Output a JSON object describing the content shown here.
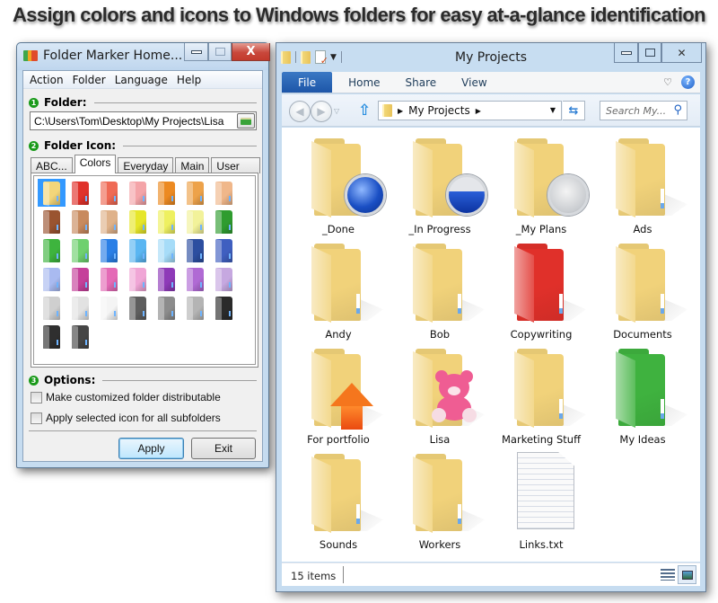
{
  "headline": "Assign colors and icons to Windows folders for easy at-a-glance identification",
  "folder_marker": {
    "title": "Folder Marker Home...",
    "caption_buttons": {
      "minimize": "minimize",
      "maximize": "maximize",
      "close": "X"
    },
    "menu": [
      "Action",
      "Folder",
      "Language",
      "Help"
    ],
    "section_folder": {
      "number": "1",
      "label": "Folder:"
    },
    "folder_path": "C:\\Users\\Tom\\Desktop\\My Projects\\Lisa",
    "section_icon": {
      "number": "2",
      "label": "Folder Icon:"
    },
    "tabs": [
      "ABC...",
      "Colors",
      "Everyday",
      "Main",
      "User Icons"
    ],
    "active_tab": "Colors",
    "color_swatches": [
      [
        "#f3d67a",
        "#e0312a",
        "#ef6a55",
        "#f4a4a8",
        "#ec8a22",
        "#eda24a",
        "#f0b78a"
      ],
      [
        "#9a5430",
        "#c88a5e",
        "#dfb28a",
        "#e6e62a",
        "#eef060",
        "#f2f29a",
        "#2f9c2f"
      ],
      [
        "#3eb43e",
        "#6fd06f",
        "#2a7fe6",
        "#5ab6f2",
        "#a6dcf8",
        "#2c4ea0",
        "#3f5fc0"
      ],
      [
        "#a9baf0",
        "#c5409a",
        "#e46ab6",
        "#f0a6d6",
        "#8e3ab8",
        "#b06ad4",
        "#c6a8e0"
      ],
      [
        "#cfcfcf",
        "#e2e2e2",
        "#f4f4f4",
        "#5e5e5e",
        "#8c8c8c",
        "#b4b4b4",
        "#2a2a2a"
      ],
      [
        "#2f2f2f",
        "#454545"
      ]
    ],
    "selected_swatch": "0,0",
    "section_options": {
      "number": "3",
      "label": "Options:"
    },
    "options": [
      {
        "label": "Make customized folder distributable",
        "checked": false
      },
      {
        "label": "Apply selected icon for all subfolders",
        "checked": false
      }
    ],
    "apply_label": "Apply",
    "exit_label": "Exit"
  },
  "explorer": {
    "title": "My Projects",
    "ribbon_tabs": [
      "File",
      "Home",
      "Share",
      "View"
    ],
    "breadcrumb": [
      "My Projects"
    ],
    "search_placeholder": "Search My...",
    "items": [
      {
        "name": "_Done",
        "type": "folder",
        "color": "#f1d27a",
        "overlay": "blue-orb-full"
      },
      {
        "name": "_In Progress",
        "type": "folder",
        "color": "#f1d27a",
        "overlay": "blue-orb-half"
      },
      {
        "name": "_My Plans",
        "type": "folder",
        "color": "#f1d27a",
        "overlay": "empty-orb"
      },
      {
        "name": "Ads",
        "type": "folder",
        "color": "#f1d27a",
        "overlay": ""
      },
      {
        "name": "Andy",
        "type": "folder",
        "color": "#f1d27a",
        "overlay": ""
      },
      {
        "name": "Bob",
        "type": "folder",
        "color": "#f1d27a",
        "overlay": ""
      },
      {
        "name": "Copywriting",
        "type": "folder",
        "color": "#e0302a",
        "overlay": ""
      },
      {
        "name": "Documents",
        "type": "folder",
        "color": "#f1d27a",
        "overlay": ""
      },
      {
        "name": "For portfolio",
        "type": "folder",
        "color": "#f1d27a",
        "overlay": "orange-up-arrow"
      },
      {
        "name": "Lisa",
        "type": "folder",
        "color": "#f1d27a",
        "overlay": "pink-teddy-bear"
      },
      {
        "name": "Marketing Stuff",
        "type": "folder",
        "color": "#f1d27a",
        "overlay": ""
      },
      {
        "name": "My Ideas",
        "type": "folder",
        "color": "#3fb23f",
        "overlay": ""
      },
      {
        "name": "Sounds",
        "type": "folder",
        "color": "#f1d27a",
        "overlay": ""
      },
      {
        "name": "Workers",
        "type": "folder",
        "color": "#f1d27a",
        "overlay": ""
      },
      {
        "name": "Links.txt",
        "type": "text-file",
        "color": "#fafafa",
        "overlay": ""
      }
    ],
    "status_count": "15 items"
  }
}
